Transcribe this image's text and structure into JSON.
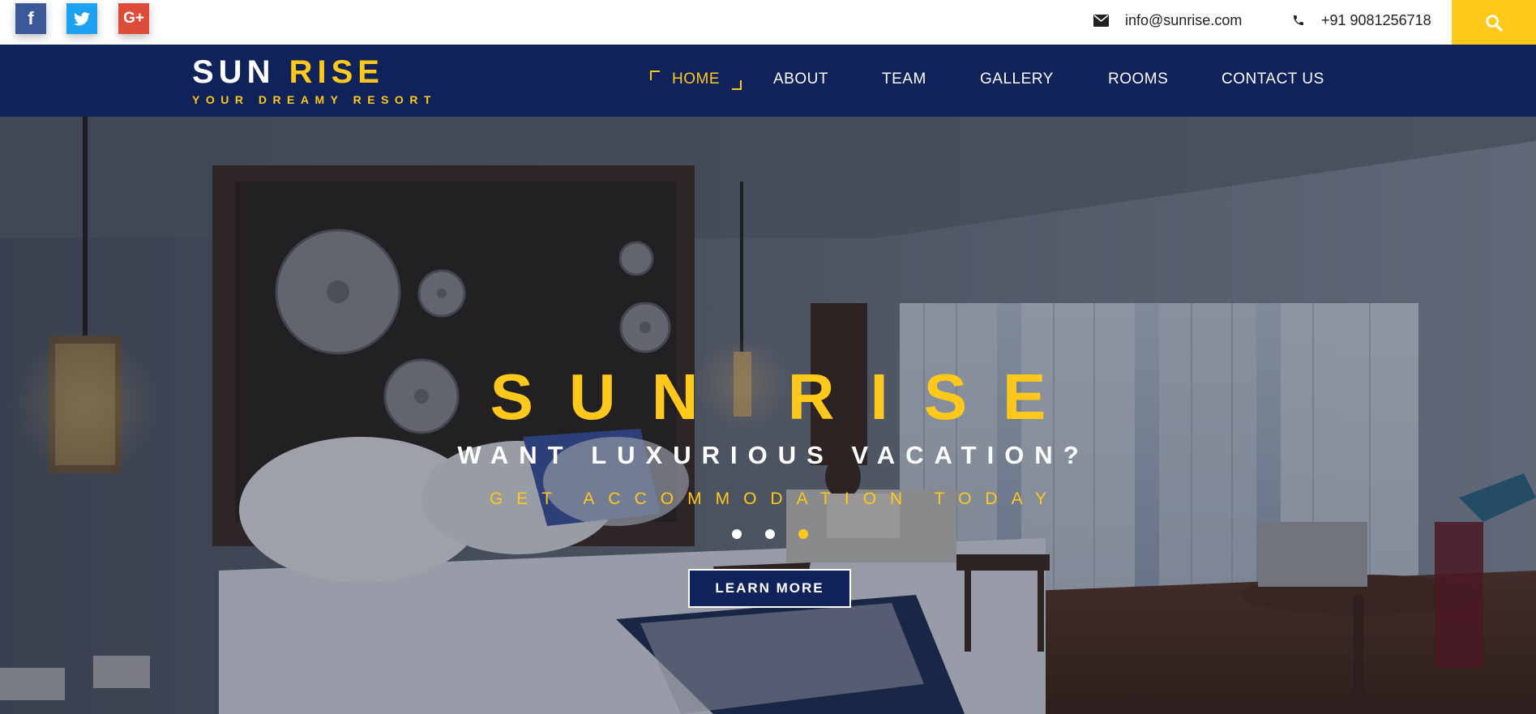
{
  "topbar": {
    "social": [
      {
        "name": "facebook",
        "glyph": "f",
        "color": "#3b5998"
      },
      {
        "name": "twitter",
        "icon": "twitter-bird-icon",
        "color": "#1da1f2"
      },
      {
        "name": "google-plus",
        "glyph": "G+",
        "color": "#dd4b39"
      }
    ],
    "email": "info@sunrise.com",
    "phone": "+91 9081256718",
    "search_icon": "search-icon"
  },
  "brand": {
    "word1": "SUN",
    "word2": "RISE",
    "tagline": "YOUR DREAMY RESORT"
  },
  "nav": {
    "items": [
      {
        "label": "HOME",
        "active": true
      },
      {
        "label": "ABOUT",
        "active": false
      },
      {
        "label": "TEAM",
        "active": false
      },
      {
        "label": "GALLERY",
        "active": false
      },
      {
        "label": "ROOMS",
        "active": false
      },
      {
        "label": "CONTACT US",
        "active": false
      }
    ]
  },
  "hero": {
    "title": "SUN RISE",
    "subtitle": "WANT LUXURIOUS VACATION?",
    "tagline": "GET ACCOMMODATION TODAY",
    "button": "LEARN MORE",
    "slides_total": 3,
    "active_slide": 3
  },
  "colors": {
    "navy": "#10225a",
    "gold": "#ffc81a",
    "white": "#ffffff"
  }
}
